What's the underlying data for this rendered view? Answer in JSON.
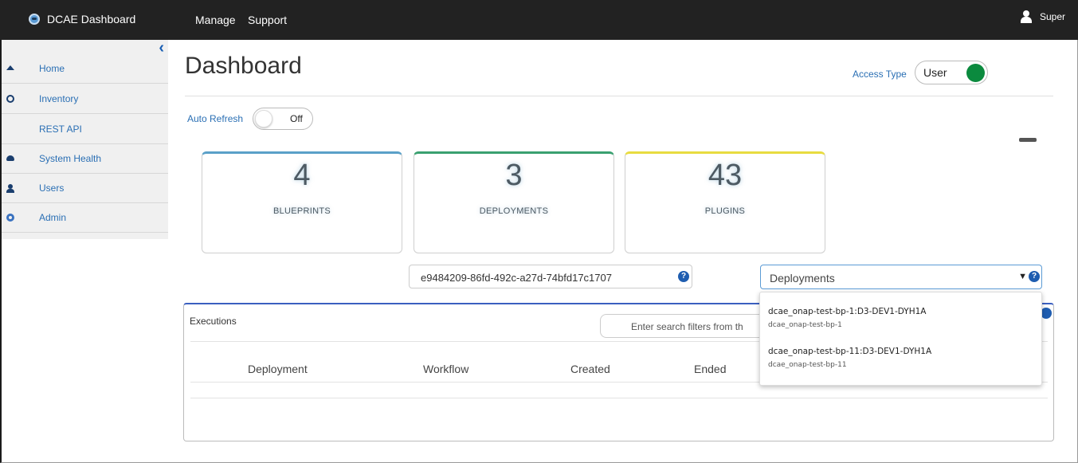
{
  "topbar": {
    "brand": "DCAE Dashboard",
    "nav": [
      "Manage",
      "Support"
    ],
    "user": "Super"
  },
  "sidebar": {
    "items": [
      {
        "label": "Home",
        "icon": "home-icon"
      },
      {
        "label": "Inventory",
        "icon": "inventory-icon"
      },
      {
        "label": "REST API",
        "icon": ""
      },
      {
        "label": "System Health",
        "icon": "cloud-icon"
      },
      {
        "label": "Users",
        "icon": "user-icon"
      },
      {
        "label": "Admin",
        "icon": "admin-icon"
      }
    ]
  },
  "page": {
    "title": "Dashboard",
    "access_type_label": "Access Type",
    "access_type_value": "User",
    "auto_refresh_label": "Auto Refresh",
    "auto_refresh_value": "Off"
  },
  "cards": [
    {
      "value": "4",
      "label": "BLUEPRINTS",
      "color": "#5aa0c8"
    },
    {
      "value": "3",
      "label": "DEPLOYMENTS",
      "color": "#3aa070"
    },
    {
      "value": "43",
      "label": "PLUGINS",
      "color": "#e8dc40"
    }
  ],
  "filters": {
    "id_value": "e9484209-86fd-492c-a27d-74bfd17c1707",
    "deployment_select": "Deployments",
    "help_glyph": "?"
  },
  "executions": {
    "title": "Executions",
    "search_placeholder": "Enter search filters from th",
    "columns": [
      "Deployment",
      "Workflow",
      "Created",
      "Ended"
    ]
  },
  "dropdown": {
    "options": [
      {
        "name": "dcae_onap-test-bp-1:D3-DEV1-DYH1A",
        "blueprint": "dcae_onap-test-bp-1"
      },
      {
        "name": "dcae_onap-test-bp-11:D3-DEV1-DYH1A",
        "blueprint": "dcae_onap-test-bp-11"
      }
    ]
  },
  "colors": {
    "topbar": "#222222",
    "link": "#2a6fb4",
    "toggle_on": "#0b8a3e",
    "panel_accent": "#3b5fc0"
  }
}
